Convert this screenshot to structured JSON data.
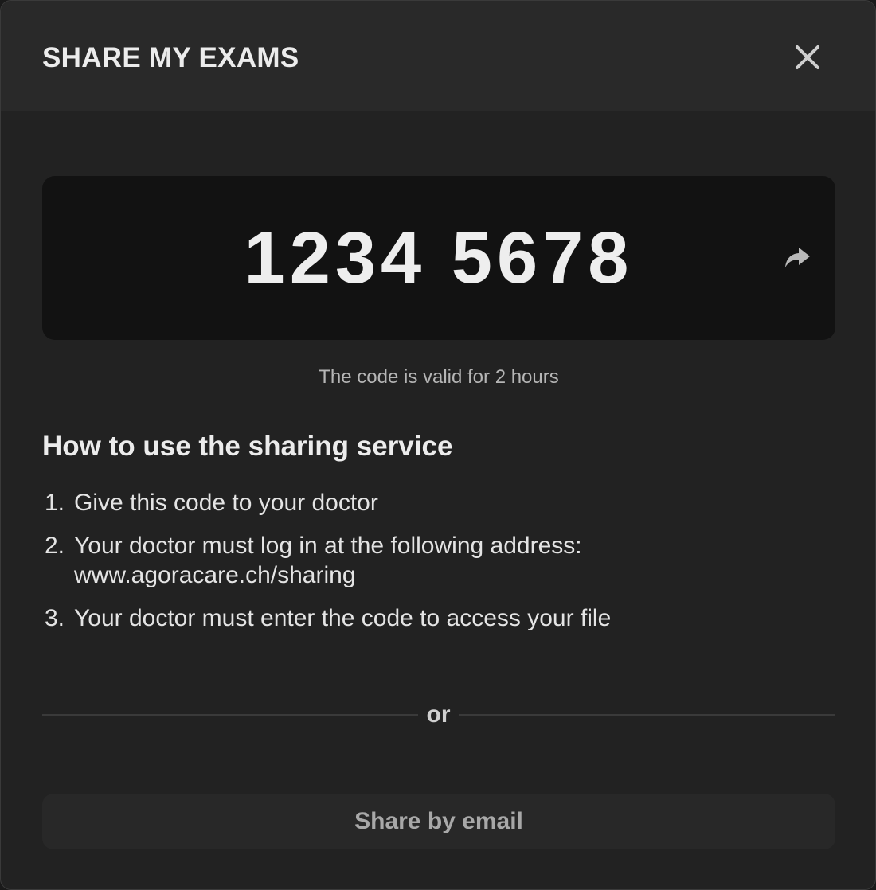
{
  "dialog": {
    "title": "SHARE MY EXAMS",
    "close_icon": "close-icon"
  },
  "code": {
    "value": "1234 5678",
    "share_icon": "share-arrow-icon",
    "validity_text": "The code is valid for 2 hours"
  },
  "instructions": {
    "heading": "How to use the sharing service",
    "steps": [
      {
        "number": "1.",
        "text": "Give this code to your doctor"
      },
      {
        "number": "2.",
        "text": "Your doctor must log in at the following address:",
        "address": "www.agoracare.ch/sharing"
      },
      {
        "number": "3.",
        "text": "Your doctor must enter the code to access your file"
      }
    ]
  },
  "divider": {
    "label": "or"
  },
  "email_button": {
    "label": "Share by email"
  },
  "colors": {
    "background": "#222222",
    "header": "#292929",
    "code_box": "#121212",
    "text": "#ececec",
    "muted_text": "#b5b5b5",
    "button": "#282828"
  }
}
